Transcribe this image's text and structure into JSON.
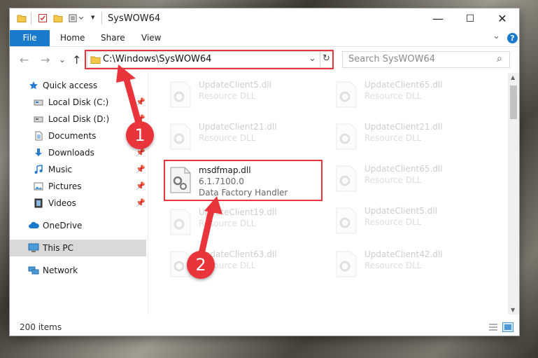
{
  "window": {
    "title": "SysWOW64",
    "controls": {
      "minimize": "—",
      "maximize": "☐",
      "close": "✕"
    }
  },
  "ribbon": {
    "file_tab": "File",
    "tabs": [
      "Home",
      "Share",
      "View"
    ],
    "expand_icon": "⌄",
    "help_icon": "?"
  },
  "address_bar": {
    "path": "C:\\Windows\\SysWOW64",
    "dropdown_icon": "⌄",
    "refresh_icon": "↻"
  },
  "search": {
    "placeholder": "Search SysWOW64",
    "icon": "⌕"
  },
  "nav_buttons": {
    "back": "←",
    "forward": "→",
    "recent": "⌄",
    "up": "↑"
  },
  "nav_pane": [
    {
      "label": "Quick access",
      "icon": "star-icon",
      "pinned": false
    },
    {
      "label": "Local Disk (C:)",
      "icon": "drive-icon",
      "pinned": true
    },
    {
      "label": "Local Disk (D:)",
      "icon": "drive-icon",
      "pinned": true
    },
    {
      "label": "Documents",
      "icon": "documents-icon",
      "pinned": true
    },
    {
      "label": "Downloads",
      "icon": "download-icon",
      "pinned": true
    },
    {
      "label": "Music",
      "icon": "music-icon",
      "pinned": true
    },
    {
      "label": "Pictures",
      "icon": "pictures-icon",
      "pinned": true
    },
    {
      "label": "Videos",
      "icon": "videos-icon",
      "pinned": true
    },
    {
      "label": "OneDrive",
      "icon": "cloud-icon",
      "pinned": false
    },
    {
      "label": "This PC",
      "icon": "computer-icon",
      "pinned": false,
      "selected": true
    },
    {
      "label": "Network",
      "icon": "network-icon",
      "pinned": false
    }
  ],
  "files": {
    "left": [
      {
        "name": "UpdateClient5.dll",
        "type": "Resource DLL"
      },
      {
        "name": "UpdateClient21.dll",
        "type": "Resource DLL"
      },
      {
        "name": "msdfmap.dll",
        "version": "6.1.7100.0",
        "type": "Data Factory Handler",
        "highlighted": true
      },
      {
        "name": "UpdateClient19.dll",
        "type": "Resource DLL"
      },
      {
        "name": "UpdateClient63.dll",
        "type": "Resource DLL"
      }
    ],
    "right": [
      {
        "name": "UpdateClient65.dll",
        "type": "Resource DLL"
      },
      {
        "name": "UpdateClient21.dll",
        "type": "Resource DLL"
      },
      {
        "name": "UpdateClient65.dll",
        "type": "Resource DLL"
      },
      {
        "name": "UpdateClient5.dll",
        "type": "Resource DLL"
      },
      {
        "name": "UpdateClient42.dll",
        "type": "Resource DLL"
      }
    ]
  },
  "status_bar": {
    "item_count": "200 items"
  },
  "annotations": {
    "badge1": "1",
    "badge2": "2"
  },
  "colors": {
    "accent": "#1979ca",
    "highlight": "#e8343a",
    "selected": "#d9d9d9"
  }
}
